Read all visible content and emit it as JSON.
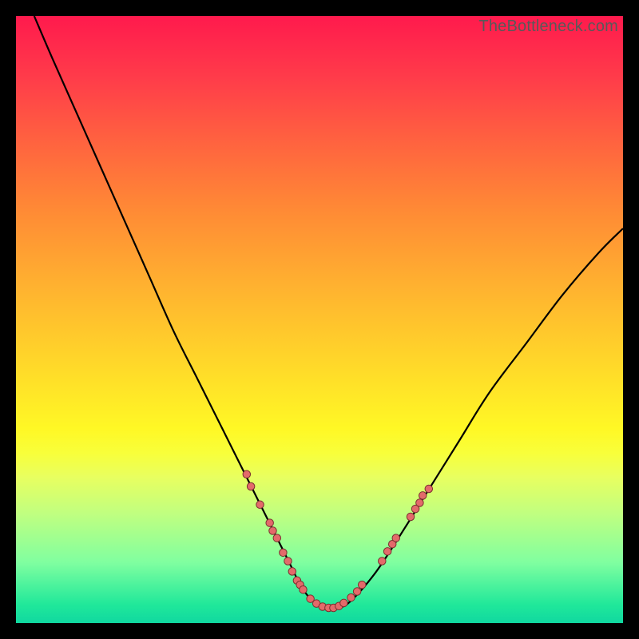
{
  "watermark": "TheBottleneck.com",
  "chart_data": {
    "type": "line",
    "title": "",
    "xlabel": "",
    "ylabel": "",
    "xlim": [
      0,
      100
    ],
    "ylim": [
      0,
      100
    ],
    "series": [
      {
        "name": "curve",
        "x": [
          3,
          6,
          10,
          14,
          18,
          22,
          26,
          30,
          34,
          38,
          42,
          45,
          47,
          49,
          51,
          53,
          55,
          59,
          63,
          68,
          73,
          78,
          84,
          90,
          96,
          100
        ],
        "y": [
          100,
          93,
          84,
          75,
          66,
          57,
          48,
          40,
          32,
          24,
          16,
          10,
          6,
          3.5,
          2.5,
          2.5,
          3.5,
          8,
          14,
          22,
          30,
          38,
          46,
          54,
          61,
          65
        ]
      }
    ],
    "markers": [
      {
        "x": 38.0,
        "y": 24.5,
        "r": 5
      },
      {
        "x": 38.7,
        "y": 22.5,
        "r": 5
      },
      {
        "x": 40.2,
        "y": 19.5,
        "r": 5
      },
      {
        "x": 41.8,
        "y": 16.5,
        "r": 5
      },
      {
        "x": 42.3,
        "y": 15.2,
        "r": 5
      },
      {
        "x": 43.0,
        "y": 14.0,
        "r": 5
      },
      {
        "x": 44.0,
        "y": 11.6,
        "r": 5
      },
      {
        "x": 44.8,
        "y": 10.2,
        "r": 5
      },
      {
        "x": 45.5,
        "y": 8.5,
        "r": 5
      },
      {
        "x": 46.3,
        "y": 7.0,
        "r": 5
      },
      {
        "x": 46.8,
        "y": 6.3,
        "r": 5
      },
      {
        "x": 47.3,
        "y": 5.5,
        "r": 5
      },
      {
        "x": 48.5,
        "y": 4.0,
        "r": 5
      },
      {
        "x": 49.5,
        "y": 3.2,
        "r": 5
      },
      {
        "x": 50.5,
        "y": 2.7,
        "r": 5
      },
      {
        "x": 51.5,
        "y": 2.5,
        "r": 5
      },
      {
        "x": 52.3,
        "y": 2.5,
        "r": 5
      },
      {
        "x": 53.2,
        "y": 2.8,
        "r": 5
      },
      {
        "x": 54.0,
        "y": 3.3,
        "r": 5
      },
      {
        "x": 55.2,
        "y": 4.2,
        "r": 5
      },
      {
        "x": 56.2,
        "y": 5.2,
        "r": 5
      },
      {
        "x": 57.0,
        "y": 6.3,
        "r": 5
      },
      {
        "x": 60.3,
        "y": 10.2,
        "r": 5
      },
      {
        "x": 61.2,
        "y": 11.8,
        "r": 5
      },
      {
        "x": 62.0,
        "y": 13.0,
        "r": 5
      },
      {
        "x": 62.6,
        "y": 14.0,
        "r": 5
      },
      {
        "x": 65.0,
        "y": 17.5,
        "r": 5
      },
      {
        "x": 65.8,
        "y": 18.8,
        "r": 5
      },
      {
        "x": 66.5,
        "y": 19.8,
        "r": 5
      },
      {
        "x": 67.0,
        "y": 21.0,
        "r": 5
      },
      {
        "x": 68.0,
        "y": 22.1,
        "r": 5
      }
    ],
    "marker_style": {
      "fill": "#e36a6a",
      "stroke": "#7a2f2f"
    }
  }
}
